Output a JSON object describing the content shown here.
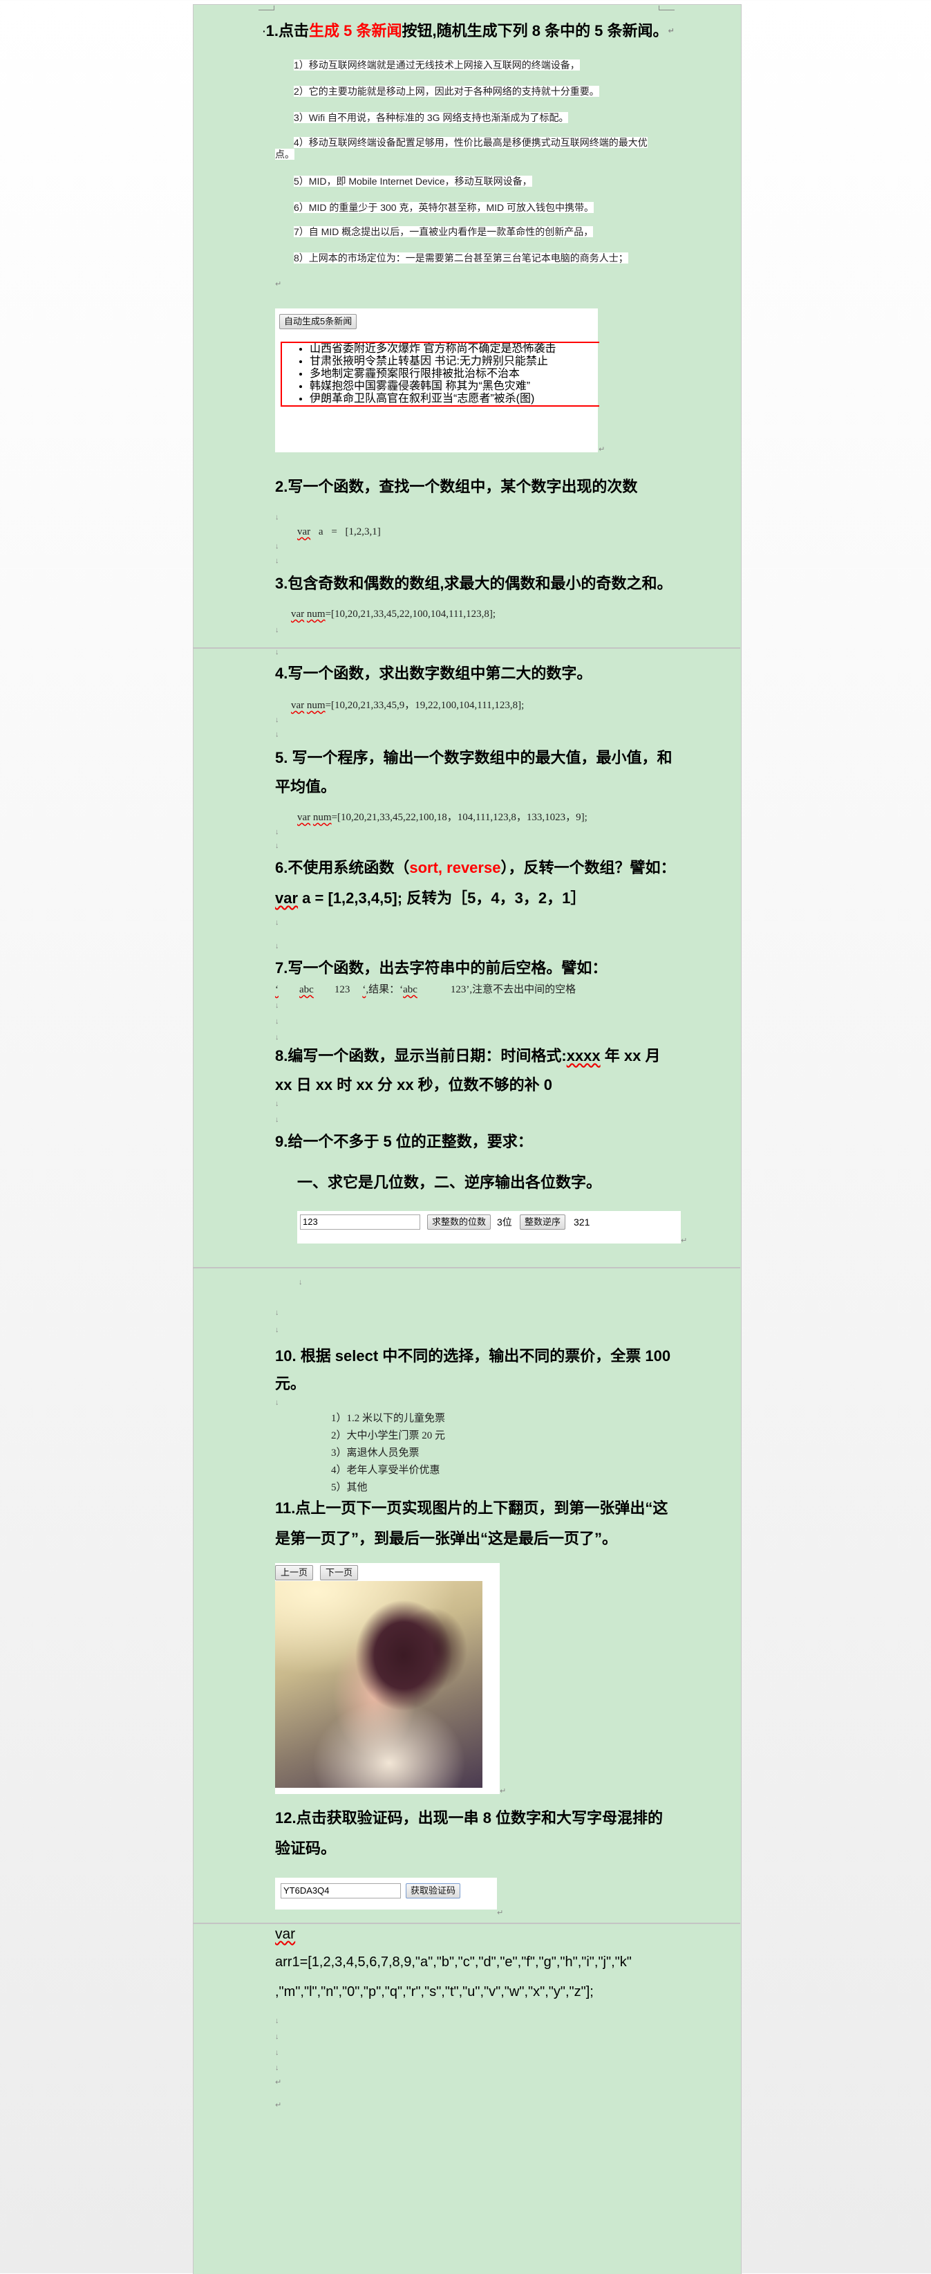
{
  "q1": {
    "title_pre": "1.点击",
    "title_red": "生成 5 条新闻",
    "title_post": "按钮,随机生成下列 8 条中的 5 条新闻。",
    "items": [
      "1）移动互联网终端就是通过无线技术上网接入互联网的终端设备，",
      "2）它的主要功能就是移动上网，因此对于各种网络的支持就十分重要。",
      "3）Wifi 自不用说，各种标准的 3G 网络支持也渐渐成为了标配。",
      "4）移动互联网终端设备配置足够用，性价比最高是移便携式动互联网终端的最大优",
      "点。",
      "5）MID，即 Mobile Internet Device，移动互联网设备，",
      "6）MID 的重量少于 300 克，英特尔甚至称，MID 可放入钱包中携带。",
      "7）自 MID 概念提出以后，一直被业内看作是一款革命性的创新产品，",
      "8）上网本的市场定位为：一是需要第二台甚至第三台笔记本电脑的商务人士；"
    ],
    "widget": {
      "button": "自动生成5条新闻",
      "news": [
        "山西省委附近多次爆炸 官方称尚不确定是恐怖袭击",
        "甘肃张掖明令禁止转基因 书记:无力辨别只能禁止",
        "多地制定雾霾预案限行限排被批治标不治本",
        "韩媒抱怨中国雾霾侵袭韩国 称其为“黑色灾难”",
        "伊朗革命卫队高官在叙利亚当“志愿者”被杀(图)"
      ],
      "border_color": "#ff0000"
    }
  },
  "q2": {
    "title": "2.写一个函数，查找一个数组中，某个数字出现的次数",
    "code_kw": "var",
    "code": " a = [1,2,3,1]"
  },
  "q3": {
    "title": "3.包含奇数和偶数的数组,求最大的偶数和最小的奇数之和。",
    "code_kw": "var",
    "code_var": "num",
    "code": "=[10,20,21,33,45,22,100,104,111,123,8];"
  },
  "q4": {
    "title": "4.写一个函数，求出数字数组中第二大的数字。",
    "code_kw": "var",
    "code_var": "num",
    "code": "=[10,20,21,33,45,9，19,22,100,104,111,123,8];"
  },
  "q5": {
    "title_l1": "5. 写一个程序，输出一个数字数组中的最大值，最小值，和",
    "title_l2": "平均值。",
    "code_kw": "var",
    "code_var": "num",
    "code": "=[10,20,21,33,45,22,100,18，104,111,123,8，133,1023，9];"
  },
  "q6": {
    "title_pre": "6.不使用系统函数（",
    "title_red": "sort, reverse",
    "title_post": "），反转一个数组？譬如：",
    "l2_kw": "var",
    "l2": " a = [1,2,3,4,5]; 反转为［5，4，3，2，1］"
  },
  "q7": {
    "title": "7.写一个函数，出去字符串中的前后空格。譬如：",
    "ex_q1": "‘",
    "ex_abc": "abc",
    "ex_123": "123",
    "ex_q2": "‘",
    "ex_res": ",结果：‘",
    "ex_abc2": "abc",
    "ex_tail": "123’,注意不去出中间的空格"
  },
  "q8": {
    "title_l1_pre": "8.编写一个函数，显示当前日期：时间格式:",
    "title_l1_x": "xxxx",
    "title_l1_post": " 年 xx 月",
    "title_l2": "xx 日 xx 时 xx 分 xx 秒，位数不够的补 0"
  },
  "q9": {
    "title": "9.给一个不多于 5 位的正整数，要求：",
    "sub": "一、求它是几位数，二、逆序输出各位数字。",
    "widget": {
      "input_value": "123",
      "digits_button": "求整数的位数",
      "digits_result": "3位",
      "reverse_button": "整数逆序",
      "reverse_result": "321"
    }
  },
  "q10": {
    "title_l1": "10. 根据 select 中不同的选择，输出不同的票价，全票 100",
    "title_l2": "元。",
    "items": [
      "1）1.2 米以下的儿童免票",
      "2）大中小学生门票 20 元",
      "3）离退休人员免票",
      "4）老年人享受半价优惠",
      "5）其他"
    ]
  },
  "q11": {
    "title_l1": "11.点上一页下一页实现图片的上下翻页，到第一张弹出“这",
    "title_l2": "是第一页了”，到最后一张弹出“这是最后一页了”。",
    "widget": {
      "prev_button": "上一页",
      "next_button": "下一页"
    }
  },
  "q12": {
    "title_l1": "12.点击获取验证码，出现一串 8 位数字和大写字母混排的",
    "title_l2": "验证码。",
    "widget": {
      "input_value": "YT6DA3Q4",
      "button": "获取验证码"
    }
  },
  "tail": {
    "kw": "var",
    "l2": "arr1=[1,2,3,4,5,6,7,8,9,\"a\",\"b\",\"c\",\"d\",\"e\",\"f\",\"g\",\"h\",\"i\",\"j\",\"k\"",
    "l3": ",\"m\",\"l\",\"n\",\"0\",\"p\",\"q\",\"r\",\"s\",\"t\",\"u\",\"v\",\"w\",\"x\",\"y\",\"z\"];"
  },
  "colors": {
    "page_background": "#cce8cf",
    "highlight": "#ff0000"
  }
}
